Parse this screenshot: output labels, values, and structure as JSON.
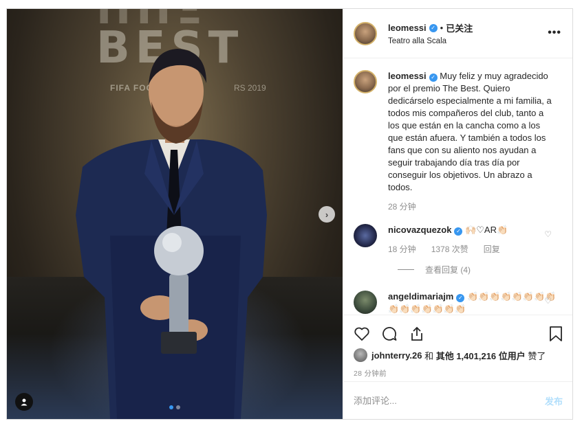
{
  "photo": {
    "bg_text_top": "ΠΠΞ",
    "bg_text": "BEST",
    "bg_sub": "FIFA FOO",
    "bg_year": "RS 2019",
    "next_icon": "chevron-right-icon",
    "tag_icon": "user-tag-icon",
    "carousel": {
      "count": 2,
      "active": 0
    }
  },
  "header": {
    "username": "leomessi",
    "verified_glyph": "✓",
    "separator": "•",
    "follow_state": "已关注",
    "location": "Teatro alla Scala",
    "more_glyph": "•••"
  },
  "caption": {
    "username": "leomessi",
    "text": "Muy feliz y muy agradecido por el premio The Best. Quiero dedicárselo especialmente a mi familia, a todos mis compañeros del club, tanto a los que están en la cancha como a los que están afuera. Y también a todos los fans que con su aliento nos ayudan a seguir trabajando día tras día por conseguir los objetivos. Un abrazo a todos.",
    "time": "28 分钟"
  },
  "comments": [
    {
      "username": "nicovazquezok",
      "text": "🙌🏻♡AR👏🏻",
      "time": "18 分钟",
      "likes": "1378 次赞",
      "reply": "回复",
      "view_replies": "查看回复 (4)"
    },
    {
      "username": "angeldimariajm",
      "text": "👏🏻👏🏻👏🏻👏🏻👏🏻👏🏻👏🏻👏🏻👏🏻👏🏻👏🏻👏🏻👏🏻👏🏻👏🏻"
    }
  ],
  "actions": {
    "like_icon": "heart-icon",
    "comment_icon": "comment-icon",
    "share_icon": "share-icon",
    "save_icon": "bookmark-icon"
  },
  "likes": {
    "first_user": "johnterry.26",
    "connector": "和",
    "others_label": "其他 1,401,216 位用户",
    "suffix": "赞了"
  },
  "timestamp": "28 分钟前",
  "comment_box": {
    "placeholder": "添加评论...",
    "post_label": "发布"
  },
  "colors": {
    "accent": "#3897f0",
    "post_disabled": "#b2dffc",
    "muted": "#8e8e8e",
    "border": "#dbdbdb"
  }
}
